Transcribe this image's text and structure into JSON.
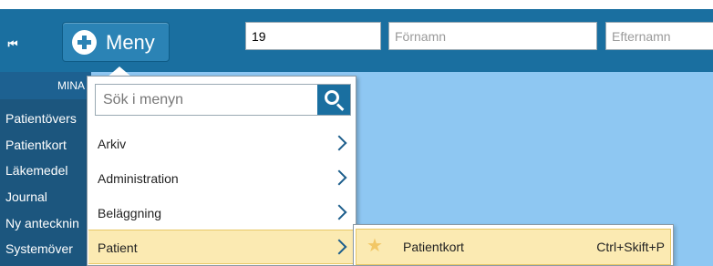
{
  "topbar": {
    "collapse_glyph": "⏮",
    "menu_label": "Meny",
    "patient_id_value": "19",
    "first_name_placeholder": "Förnamn",
    "last_name_placeholder": "Efternamn"
  },
  "sidebar": {
    "header": "MINA",
    "items": [
      "Patientövers",
      "Patientkort",
      "Läkemedel",
      "Journal",
      "Ny antecknin",
      "Systemöver"
    ]
  },
  "dropdown": {
    "search_placeholder": "Sök i menyn",
    "items": [
      {
        "label": "Arkiv",
        "has_submenu": true
      },
      {
        "label": "Administration",
        "has_submenu": true
      },
      {
        "label": "Beläggning",
        "has_submenu": true
      },
      {
        "label": "Patient",
        "has_submenu": true,
        "active": true
      }
    ]
  },
  "submenu": {
    "items": [
      {
        "icon": "star-icon",
        "label": "Patientkort",
        "shortcut": "Ctrl+Skift+P"
      }
    ]
  },
  "colors": {
    "topbar": "#1a6fa0",
    "content_bg": "#8ec7f2",
    "sidebar": "#1c567e",
    "highlight": "#fbeab2"
  }
}
